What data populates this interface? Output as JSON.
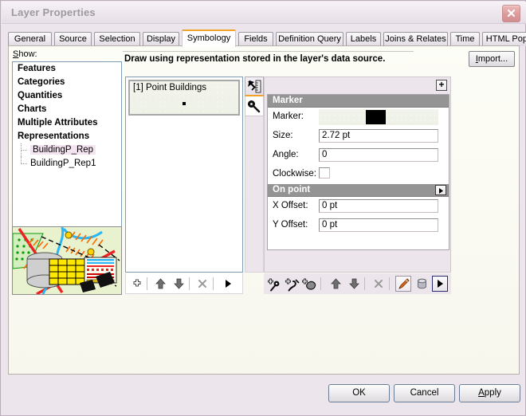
{
  "window": {
    "title": "Layer Properties",
    "close_icon": "close-icon"
  },
  "tabs": [
    {
      "label": "General",
      "active": false
    },
    {
      "label": "Source",
      "active": false
    },
    {
      "label": "Selection",
      "active": false
    },
    {
      "label": "Display",
      "active": false
    },
    {
      "label": "Symbology",
      "active": true
    },
    {
      "label": "Fields",
      "active": false
    },
    {
      "label": "Definition Query",
      "active": false
    },
    {
      "label": "Labels",
      "active": false
    },
    {
      "label": "Joins & Relates",
      "active": false
    },
    {
      "label": "Time",
      "active": false
    },
    {
      "label": "HTML Popup",
      "active": false
    }
  ],
  "show": {
    "label": "Show:",
    "label_accel": "S",
    "label_rest": "how:",
    "categories": [
      "Features",
      "Categories",
      "Quantities",
      "Charts",
      "Multiple Attributes",
      "Representations"
    ],
    "representations": [
      {
        "label": "BuildingP_Rep",
        "selected": true
      },
      {
        "label": "BuildingP_Rep1",
        "selected": false
      }
    ],
    "scrollbar": {
      "left_icon": "chevron-left-icon",
      "right_icon": "chevron-right-icon"
    }
  },
  "description": {
    "text": "Draw using representation stored in the layer's data source.",
    "import_accel": "I",
    "import_rest": "mport..."
  },
  "rules": {
    "items": [
      {
        "label": "[1] Point Buildings",
        "preview": "point-dot"
      }
    ]
  },
  "vertical_tabs": [
    {
      "name": "rule-tool-tab",
      "icon": "ruler-arrow-icon",
      "active": true
    },
    {
      "name": "key-tool-tab",
      "icon": "magnifier-key-icon",
      "active": false
    }
  ],
  "properties": {
    "expand_label": "+",
    "groups": [
      {
        "title": "Marker",
        "has_arrow": false,
        "rows": [
          {
            "label": "Marker:",
            "type": "swatch",
            "value": "#000000"
          },
          {
            "label": "Size:",
            "type": "text",
            "value": "2.72 pt"
          },
          {
            "label": "Angle:",
            "type": "text",
            "value": "0"
          },
          {
            "label": "Clockwise:",
            "type": "checkbox",
            "value": ""
          }
        ]
      },
      {
        "title": "On point",
        "has_arrow": true,
        "rows": [
          {
            "label": "X Offset:",
            "type": "text",
            "value": "0 pt"
          },
          {
            "label": "Y Offset:",
            "type": "text",
            "value": "0 pt"
          }
        ]
      }
    ]
  },
  "left_toolbar": [
    {
      "name": "add-rule-button",
      "icon": "plus-cross-icon"
    },
    {
      "name": "move-rule-up-button",
      "icon": "arrow-up-icon"
    },
    {
      "name": "move-rule-down-button",
      "icon": "arrow-down-icon"
    },
    {
      "name": "delete-rule-button",
      "icon": "x-icon"
    },
    {
      "name": "rule-menu-button",
      "icon": "play-triangle-icon"
    }
  ],
  "right_toolbar": [
    {
      "name": "add-marker-layer-button",
      "icon": "add-marker-icon"
    },
    {
      "name": "add-line-layer-button",
      "icon": "add-line-icon"
    },
    {
      "name": "add-fill-layer-button",
      "icon": "add-fill-icon"
    },
    {
      "name": "move-layer-up-button",
      "icon": "arrow-up-icon"
    },
    {
      "name": "move-layer-down-button",
      "icon": "arrow-down-icon"
    },
    {
      "name": "delete-layer-button",
      "icon": "x-icon"
    },
    {
      "name": "geometric-effect-button",
      "icon": "paintbrush-icon"
    },
    {
      "name": "global-effect-button",
      "icon": "cylinder-icon"
    },
    {
      "name": "layer-menu-button",
      "icon": "play-triangle-icon"
    }
  ],
  "dialog_buttons": {
    "ok": "OK",
    "cancel": "Cancel",
    "apply_accel": "A",
    "apply_rest": "pply"
  },
  "colors": {
    "accent_orange": "#f0a22a",
    "window_bg": "#ece5ec",
    "page_bg": "#fbfaf3",
    "group_header": "#949494",
    "selection_pink": "#f4e3f0",
    "marker_color": "#000000"
  }
}
